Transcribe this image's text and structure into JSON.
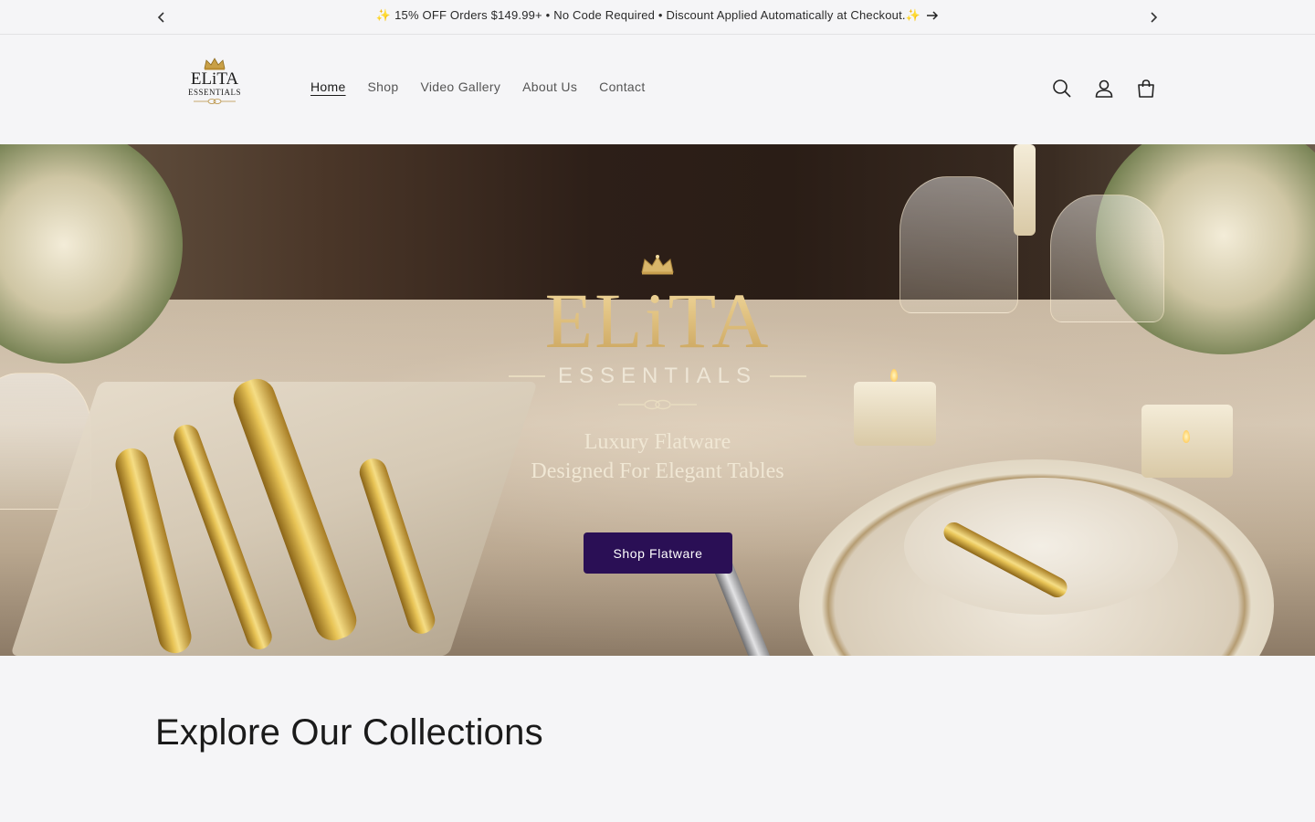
{
  "announcement": {
    "text": "✨ 15% OFF Orders $149.99+ • No Code Required • Discount Applied Automatically at Checkout.✨",
    "prev_icon": "chevron-left-icon",
    "next_icon": "chevron-right-icon",
    "link_icon": "arrow-right-icon"
  },
  "header": {
    "logo": {
      "text": "ELiTA",
      "sub": "ESSENTIALS"
    },
    "nav": [
      {
        "label": "Home",
        "active": true
      },
      {
        "label": "Shop",
        "active": false
      },
      {
        "label": "Video Gallery",
        "active": false
      },
      {
        "label": "About Us",
        "active": false
      },
      {
        "label": "Contact",
        "active": false
      }
    ],
    "icons": [
      "search-icon",
      "account-icon",
      "cart-icon"
    ]
  },
  "hero": {
    "brand_main": "ELiTA",
    "brand_sub": "ESSENTIALS",
    "tagline_line1": "Luxury Flatware",
    "tagline_line2": "Designed For Elegant Tables",
    "cta_label": "Shop Flatware",
    "cta_color": "#2a0f55"
  },
  "collections": {
    "title": "Explore Our Collections"
  }
}
